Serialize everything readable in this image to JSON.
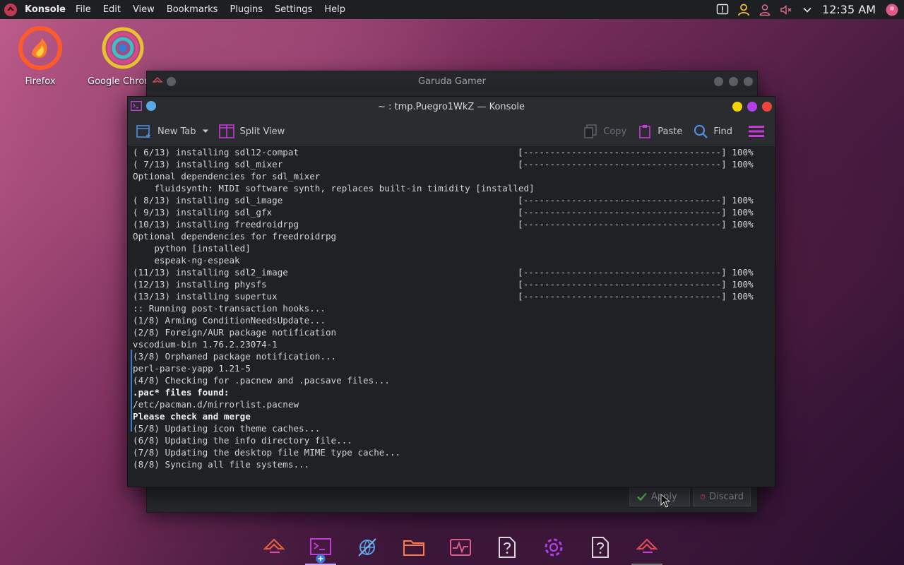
{
  "panel": {
    "app_name": "Konsole",
    "menu": [
      "File",
      "Edit",
      "View",
      "Bookmarks",
      "Plugins",
      "Settings",
      "Help"
    ],
    "clock": "12:35 AM"
  },
  "desktop": {
    "icons": [
      {
        "label": "Firefox"
      },
      {
        "label": "Google Chrome"
      }
    ]
  },
  "back_window": {
    "title": "Garuda Gamer",
    "apply_label": "Apply",
    "discard_label": "Discard"
  },
  "konsole": {
    "title": "~ : tmp.Puegro1WkZ — Konsole",
    "toolbar": {
      "new_tab": "New Tab",
      "split_view": "Split View",
      "copy": "Copy",
      "paste": "Paste",
      "find": "Find"
    },
    "lines": [
      {
        "text": "( 6/13) installing sdl12-compat",
        "bar": "[-------------------------------------] 100%"
      },
      {
        "text": "( 7/13) installing sdl_mixer",
        "bar": "[-------------------------------------] 100%"
      },
      {
        "text": "Optional dependencies for sdl_mixer",
        "bar": ""
      },
      {
        "text": "    fluidsynth: MIDI software synth, replaces built-in timidity [installed]",
        "bar": ""
      },
      {
        "text": "( 8/13) installing sdl_image",
        "bar": "[-------------------------------------] 100%"
      },
      {
        "text": "( 9/13) installing sdl_gfx",
        "bar": "[-------------------------------------] 100%"
      },
      {
        "text": "(10/13) installing freedroidrpg",
        "bar": "[-------------------------------------] 100%"
      },
      {
        "text": "Optional dependencies for freedroidrpg",
        "bar": ""
      },
      {
        "text": "    python [installed]",
        "bar": ""
      },
      {
        "text": "    espeak-ng-espeak",
        "bar": ""
      },
      {
        "text": "(11/13) installing sdl2_image",
        "bar": "[-------------------------------------] 100%"
      },
      {
        "text": "(12/13) installing physfs",
        "bar": "[-------------------------------------] 100%"
      },
      {
        "text": "(13/13) installing supertux",
        "bar": "[-------------------------------------] 100%"
      },
      {
        "text": ":: Running post-transaction hooks...",
        "bar": ""
      },
      {
        "text": "(1/8) Arming ConditionNeedsUpdate...",
        "bar": ""
      },
      {
        "text": "(2/8) Foreign/AUR package notification",
        "bar": ""
      },
      {
        "text": "vscodium-bin 1.76.2.23074-1",
        "bar": ""
      },
      {
        "text": "(3/8) Orphaned package notification...",
        "bar": ""
      },
      {
        "text": "perl-parse-yapp 1.21-5",
        "bar": ""
      },
      {
        "text": "(4/8) Checking for .pacnew and .pacsave files...",
        "bar": ""
      },
      {
        "text": ".pac* files found:",
        "bar": "",
        "bold": true
      },
      {
        "text": "/etc/pacman.d/mirrorlist.pacnew",
        "bar": ""
      },
      {
        "text": "Please check and merge",
        "bar": "",
        "bold": true
      },
      {
        "text": "(5/8) Updating icon theme caches...",
        "bar": ""
      },
      {
        "text": "(6/8) Updating the info directory file...",
        "bar": ""
      },
      {
        "text": "(7/8) Updating the desktop file MIME type cache...",
        "bar": ""
      },
      {
        "text": "(8/8) Syncing all file systems...",
        "bar": ""
      }
    ]
  },
  "colors": {
    "accent_blue": "#3b7bd6",
    "dot_yellow": "#f5d400",
    "dot_purple": "#b23ee8",
    "dot_red": "#f0433c",
    "accent_pink": "#c33ad8"
  }
}
